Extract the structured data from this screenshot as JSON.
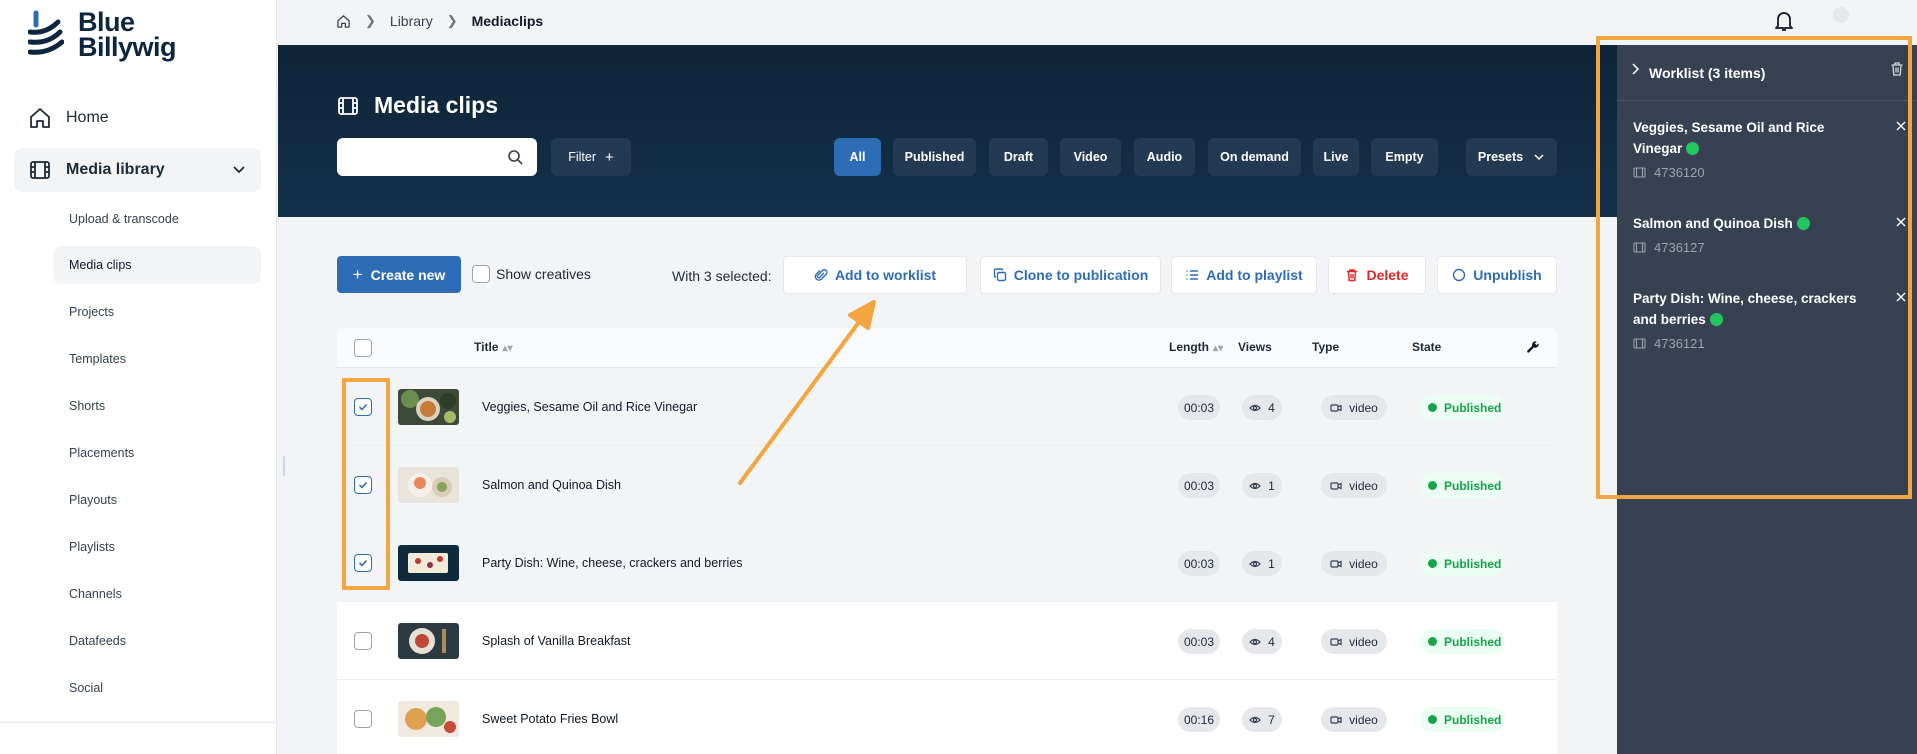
{
  "brand": {
    "line1": "Blue",
    "line2": "Billywig"
  },
  "sidebar": {
    "home": "Home",
    "media_library": "Media library",
    "items": [
      "Upload & transcode",
      "Media clips",
      "Projects",
      "Templates",
      "Shorts",
      "Placements",
      "Playouts",
      "Playlists",
      "Channels",
      "Datafeeds",
      "Social"
    ],
    "active": "Media clips"
  },
  "breadcrumb": {
    "library": "Library",
    "current": "Mediaclips"
  },
  "header": {
    "title": "Media clips",
    "search_placeholder": "",
    "filter_label": "Filter",
    "chips": [
      "All",
      "Published",
      "Draft",
      "Video",
      "Audio",
      "On demand",
      "Live",
      "Empty"
    ],
    "presets_label": "Presets",
    "active_chip": "All"
  },
  "actions": {
    "create_new": "Create new",
    "show_creatives": "Show creatives",
    "with_selected": "With 3 selected:",
    "add_to_worklist": "Add to worklist",
    "clone_to_publication": "Clone to publication",
    "add_to_playlist": "Add to playlist",
    "delete": "Delete",
    "unpublish": "Unpublish"
  },
  "table": {
    "columns": {
      "title": "Title",
      "length": "Length",
      "views": "Views",
      "type": "Type",
      "state": "State"
    },
    "rows": [
      {
        "title": "Veggies, Sesame Oil and Rice Vinegar",
        "length": "00:03",
        "views": "4",
        "type": "video",
        "state": "Published",
        "selected": true
      },
      {
        "title": "Salmon and Quinoa Dish",
        "length": "00:03",
        "views": "1",
        "type": "video",
        "state": "Published",
        "selected": true
      },
      {
        "title": "Party Dish: Wine, cheese, crackers and berries",
        "length": "00:03",
        "views": "1",
        "type": "video",
        "state": "Published",
        "selected": true
      },
      {
        "title": "Splash of Vanilla Breakfast",
        "length": "00:03",
        "views": "4",
        "type": "video",
        "state": "Published",
        "selected": false
      },
      {
        "title": "Sweet Potato Fries Bowl",
        "length": "00:16",
        "views": "7",
        "type": "video",
        "state": "Published",
        "selected": false
      }
    ]
  },
  "worklist": {
    "title": "Worklist (3 items)",
    "items": [
      {
        "name": "Veggies, Sesame Oil and Rice Vinegar",
        "id": "4736120"
      },
      {
        "name": "Salmon and Quinoa Dish",
        "id": "4736127"
      },
      {
        "name": "Party Dish: Wine, cheese, crackers and berries",
        "id": "4736121"
      }
    ]
  },
  "colors": {
    "accent": "#2e6db6",
    "header_bg": "#0d2438",
    "published": "#16a34a",
    "annotation": "#f2a541",
    "panel_bg": "#374151"
  }
}
